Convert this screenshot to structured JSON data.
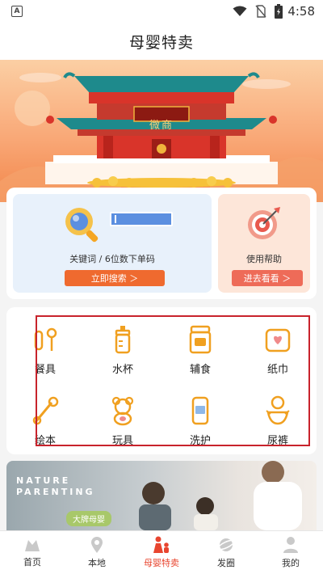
{
  "status_bar": {
    "app_badge": "A",
    "time": "4:58",
    "icons": [
      "wifi-icon",
      "no-sim-icon",
      "battery-charging-icon"
    ]
  },
  "header": {
    "title": "母婴特卖"
  },
  "banner": {
    "sign_text": "微商"
  },
  "search_card": {
    "caption": "关键词 / 6位数下单码",
    "button_label": "立即搜索 ＞"
  },
  "help_card": {
    "caption": "使用帮助",
    "button_label": "进去看看 ＞"
  },
  "categories": [
    {
      "label": "餐具",
      "icon": "tableware-icon"
    },
    {
      "label": "水杯",
      "icon": "baby-bottle-icon"
    },
    {
      "label": "辅食",
      "icon": "baby-food-jar-icon"
    },
    {
      "label": "纸巾",
      "icon": "tissue-box-icon"
    },
    {
      "label": "绘本",
      "icon": "picture-book-icon"
    },
    {
      "label": "玩具",
      "icon": "teddy-bear-icon"
    },
    {
      "label": "洗护",
      "icon": "lotion-icon"
    },
    {
      "label": "尿裤",
      "icon": "diaper-icon"
    }
  ],
  "promo": {
    "line1": "NATURE",
    "line2": "PARENTING",
    "pill": "大牌母婴"
  },
  "tabs": [
    {
      "label": "首页",
      "icon": "home-icon"
    },
    {
      "label": "本地",
      "icon": "location-pin-icon"
    },
    {
      "label": "母婴特卖",
      "icon": "mother-baby-icon",
      "active": true
    },
    {
      "label": "发圈",
      "icon": "planet-icon"
    },
    {
      "label": "我的",
      "icon": "user-icon"
    }
  ],
  "colors": {
    "accent": "#ef6a2f",
    "active_tab": "#e8452f",
    "highlight_box": "#c8232c",
    "icon_orange": "#f0a020"
  }
}
